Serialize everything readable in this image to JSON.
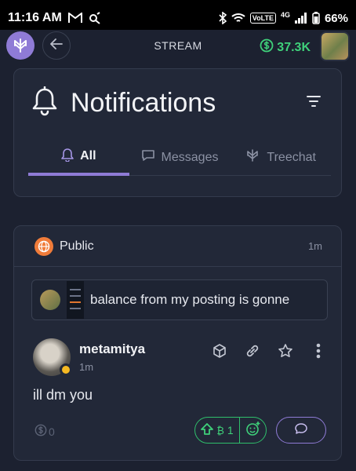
{
  "status_bar": {
    "time": "11:16 AM",
    "network": "4G",
    "volte": "VoLTE",
    "battery": "66%"
  },
  "app_header": {
    "title": "STREAM",
    "balance": "37.3K"
  },
  "notifications": {
    "title": "Notifications",
    "tabs": [
      {
        "label": "All",
        "icon": "bell-icon",
        "active": true
      },
      {
        "label": "Messages",
        "icon": "chat-icon",
        "active": false
      },
      {
        "label": "Treechat",
        "icon": "treechat-icon",
        "active": false
      }
    ]
  },
  "post": {
    "visibility": "Public",
    "time": "1m",
    "quoted_text": "balance from my posting is gonne",
    "author": {
      "name": "metamitya",
      "time": "1m"
    },
    "body": "ill dm you",
    "tip_count": "0",
    "boost_label": "1"
  },
  "colors": {
    "background": "#1c2130",
    "card": "#222838",
    "accent_purple": "#8f7bd6",
    "accent_green": "#3fd07a",
    "public_orange": "#f07c3a"
  }
}
